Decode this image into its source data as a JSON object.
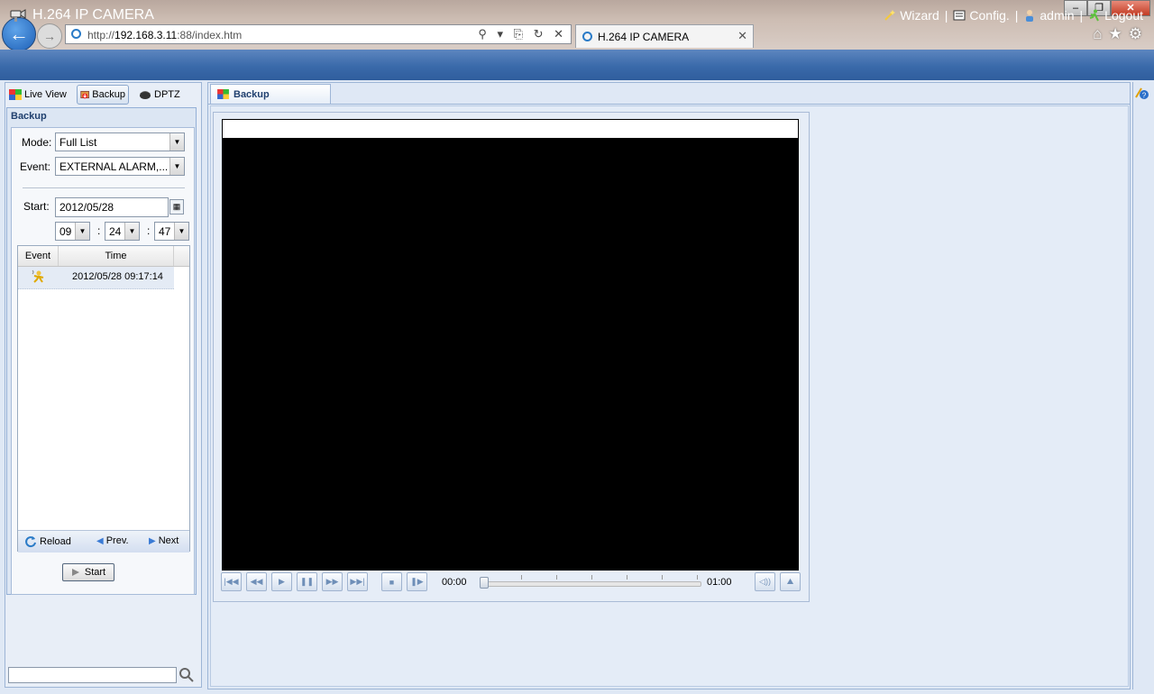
{
  "browser": {
    "url_prefix": "http://",
    "url_host": "192.168.3.11",
    "url_rest": ":88/index.htm",
    "tab_title": "H.264 IP CAMERA",
    "tab_close": "✕",
    "address_icons": "⚲ ▾ ⎘ ↻ ✕",
    "right_icons": "⌂★⚙",
    "window_buttons": {
      "minimize": "–",
      "maximize": "❐",
      "close": "✕"
    }
  },
  "app": {
    "title": "H.264 IP CAMERA",
    "links": {
      "wizard": "Wizard",
      "config": "Config.",
      "admin": "admin",
      "logout": "Logout",
      "separator": "|"
    }
  },
  "left": {
    "tabs": {
      "live_view": "Live View",
      "backup": "Backup",
      "dptz": "DPTZ"
    },
    "panel_title": "Backup",
    "mode_label": "Mode:",
    "mode_value": "Full List",
    "event_label": "Event:",
    "event_value": "EXTERNAL ALARM,...",
    "start_label": "Start:",
    "start_date": "2012/05/28",
    "time": {
      "hour": "09",
      "minute": "24",
      "second": "47",
      "colon": ":"
    },
    "list": {
      "headers": {
        "event": "Event",
        "time": "Time"
      },
      "rows": [
        {
          "time": "2012/05/28 09:17:14"
        }
      ]
    },
    "footer": {
      "reload": "Reload",
      "prev": "Prev.",
      "next": "Next"
    },
    "start_button": "Start",
    "search_placeholder": ""
  },
  "main": {
    "tab_label": "Backup",
    "time_start": "00:00",
    "time_end": "01:00",
    "progress": 0
  },
  "colors": {
    "header_bar": "#3a6aaa",
    "video_bg": "#000000",
    "panel_bg": "#dfe8f5"
  }
}
